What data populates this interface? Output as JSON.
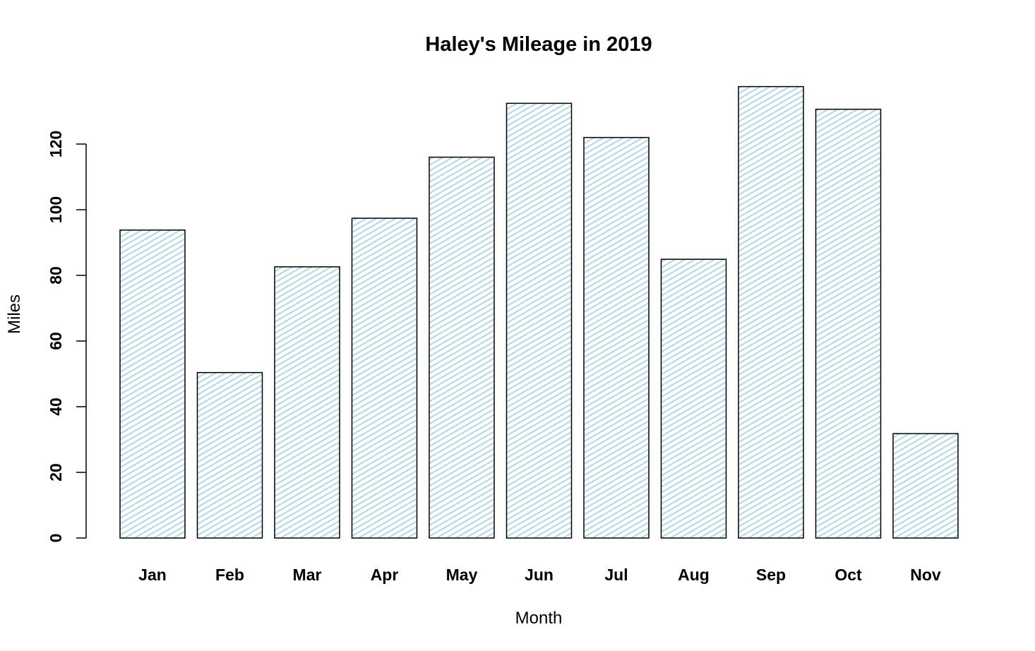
{
  "chart_data": {
    "type": "bar",
    "title": "Haley's Mileage in 2019",
    "xlabel": "Month",
    "ylabel": "Miles",
    "categories": [
      "Jan",
      "Feb",
      "Mar",
      "Apr",
      "May",
      "Jun",
      "Jul",
      "Aug",
      "Sep",
      "Oct",
      "Nov"
    ],
    "values": [
      93.8,
      50.4,
      82.6,
      97.4,
      116.0,
      132.4,
      122.0,
      84.9,
      137.5,
      130.6,
      31.8
    ],
    "yticks": [
      0,
      20,
      40,
      60,
      80,
      100,
      120
    ],
    "ylim": [
      0,
      140
    ],
    "grid": false,
    "legend": "none",
    "bar_fill": "hatched",
    "hatch_color": "#add8e6",
    "border_color": "#000000"
  }
}
